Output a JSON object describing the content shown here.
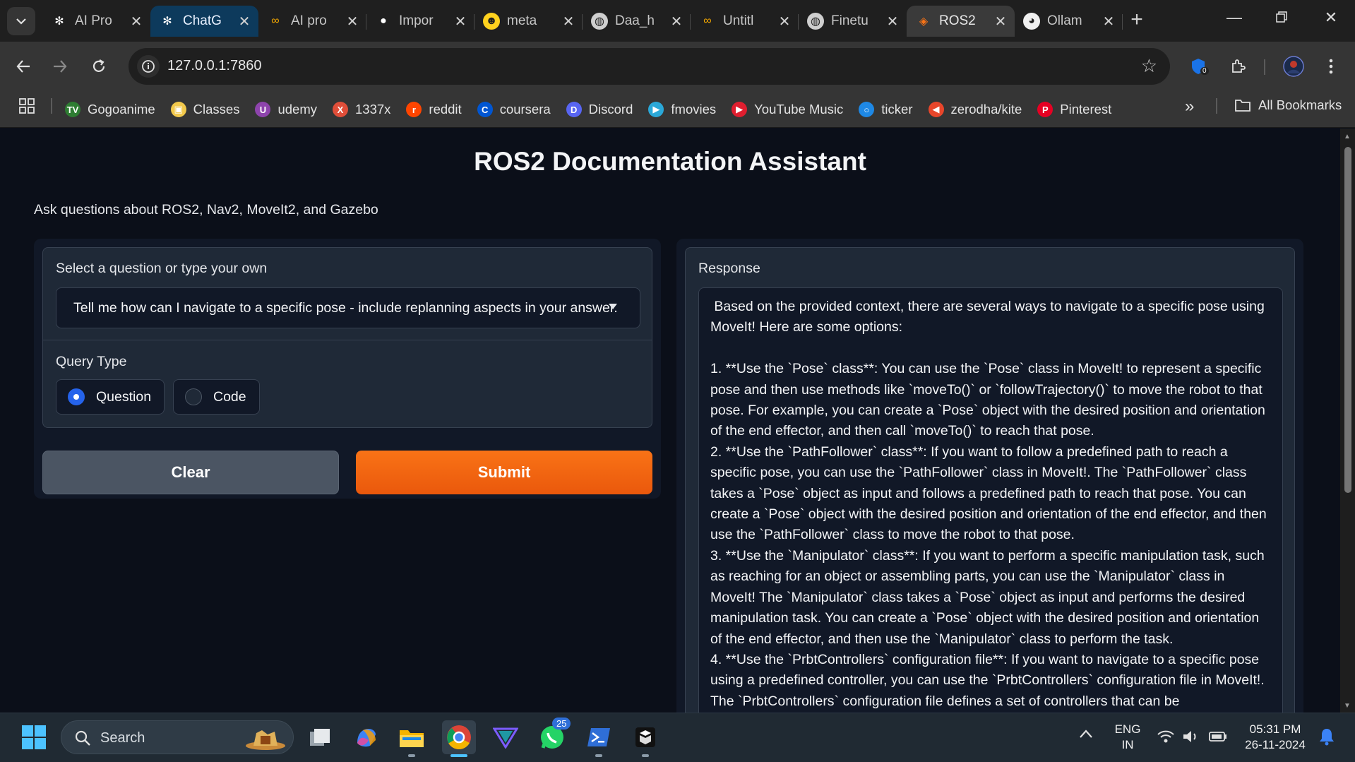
{
  "browser": {
    "tabs": [
      {
        "title": "AI Pro",
        "icon": "openai-icon"
      },
      {
        "title": "ChatG",
        "icon": "chatgpt-icon",
        "active": true
      },
      {
        "title": "AI pro",
        "icon": "colab-icon"
      },
      {
        "title": "Impor",
        "icon": "github-icon"
      },
      {
        "title": "meta",
        "icon": "huggingface-icon"
      },
      {
        "title": "Daa_h",
        "icon": "globe-icon"
      },
      {
        "title": "Untitl",
        "icon": "colab-icon"
      },
      {
        "title": "Finetu",
        "icon": "globe-icon"
      },
      {
        "title": "ROS2",
        "icon": "gradio-icon",
        "current": true
      },
      {
        "title": "Ollam",
        "icon": "ollama-icon"
      }
    ],
    "url": "127.0.0.1:7860",
    "extension_badge": "0",
    "bookmarks": [
      {
        "label": "Gogoanime",
        "icon": "gogoanime-icon",
        "color": "#2e7d32",
        "glyph": "TV"
      },
      {
        "label": "Classes",
        "icon": "classes-icon",
        "color": "#f2c94c",
        "glyph": "▣"
      },
      {
        "label": "udemy",
        "icon": "udemy-icon",
        "color": "#8e44ad",
        "glyph": "U"
      },
      {
        "label": "1337x",
        "icon": "x-icon",
        "color": "#e04e39",
        "glyph": "X"
      },
      {
        "label": "reddit",
        "icon": "reddit-icon",
        "color": "#ff4500",
        "glyph": "r"
      },
      {
        "label": "coursera",
        "icon": "coursera-icon",
        "color": "#0056d2",
        "glyph": "C"
      },
      {
        "label": "Discord",
        "icon": "discord-icon",
        "color": "#5865f2",
        "glyph": "D"
      },
      {
        "label": "fmovies",
        "icon": "fmovies-icon",
        "color": "#2aa8d8",
        "glyph": "▶"
      },
      {
        "label": "YouTube Music",
        "icon": "youtube-music-icon",
        "color": "#e01e2f",
        "glyph": "▶"
      },
      {
        "label": "ticker",
        "icon": "ticker-icon",
        "color": "#1e88e5",
        "glyph": "○"
      },
      {
        "label": "zerodha/kite",
        "icon": "kite-icon",
        "color": "#e8462b",
        "glyph": "◀"
      },
      {
        "label": "Pinterest",
        "icon": "pinterest-icon",
        "color": "#e60023",
        "glyph": "P"
      }
    ],
    "all_bookmarks": "All Bookmarks"
  },
  "app": {
    "title": "ROS2 Documentation Assistant",
    "description": "Ask questions about ROS2, Nav2, MoveIt2, and Gazebo",
    "question_label": "Select a question or type your own",
    "question_value": "Tell me how can I navigate to a specific pose - include replanning aspects in your answer.",
    "query_type_label": "Query Type",
    "query_options": [
      "Question",
      "Code"
    ],
    "selected_query_type": "Question",
    "clear_label": "Clear",
    "submit_label": "Submit",
    "response_label": "Response",
    "response_text": " Based on the provided context, there are several ways to navigate to a specific pose using MoveIt! Here are some options:\n\n1. **Use the `Pose` class**: You can use the `Pose` class in MoveIt! to represent a specific pose and then use methods like `moveTo()` or `followTrajectory()` to move the robot to that pose. For example, you can create a `Pose` object with the desired position and orientation of the end effector, and then call `moveTo()` to reach that pose.\n2. **Use the `PathFollower` class**: If you want to follow a predefined path to reach a specific pose, you can use the `PathFollower` class in MoveIt!. The `PathFollower` class takes a `Pose` object as input and follows a predefined path to reach that pose. You can create a `Pose` object with the desired position and orientation of the end effector, and then use the `PathFollower` class to move the robot to that pose.\n3. **Use the `Manipulator` class**: If you want to perform a specific manipulation task, such as reaching for an object or assembling parts, you can use the `Manipulator` class in MoveIt! The `Manipulator` class takes a `Pose` object as input and performs the desired manipulation task. You can create a `Pose` object with the desired position and orientation of the end effector, and then use the `Manipulator` class to perform the task.\n4. **Use the `PrbtControllers` configuration file**: If you want to navigate to a specific pose using a predefined controller, you can use the `PrbtControllers` configuration file in MoveIt!. The `PrbtControllers` configuration file defines a set of controllers that can be",
    "accent_color": "#f97316",
    "radio_color": "#2563eb"
  },
  "taskbar": {
    "search_placeholder": "Search",
    "whatsapp_badge": "25",
    "lang_line1": "ENG",
    "lang_line2": "IN",
    "time": "05:31 PM",
    "date": "26-11-2024"
  }
}
